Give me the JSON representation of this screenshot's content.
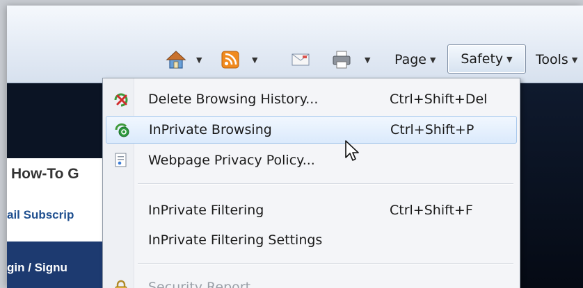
{
  "toolbar": {
    "items": [
      {
        "id": "home",
        "icon": "home-icon"
      },
      {
        "id": "feeds",
        "icon": "rss-feed-icon"
      },
      {
        "id": "mail",
        "icon": "mail-icon"
      },
      {
        "id": "print",
        "icon": "printer-icon"
      }
    ],
    "page_label": "Page",
    "safety_label": "Safety",
    "tools_label": "Tools"
  },
  "page": {
    "heading_partial": "How-To G",
    "subscribe_partial": "ail Subscrip",
    "login_partial": "gin / Signu"
  },
  "safety_menu": {
    "items": [
      {
        "label": "Delete Browsing History...",
        "shortcut": "Ctrl+Shift+Del",
        "icon": "delete-history-icon",
        "highlighted": false,
        "disabled": false
      },
      {
        "label": "InPrivate Browsing",
        "shortcut": "Ctrl+Shift+P",
        "icon": "inprivate-icon",
        "highlighted": true,
        "disabled": false
      },
      {
        "label": "Webpage Privacy Policy...",
        "shortcut": "",
        "icon": "privacy-policy-icon",
        "highlighted": false,
        "disabled": false
      },
      {
        "label": "InPrivate Filtering",
        "shortcut": "Ctrl+Shift+F",
        "icon": "",
        "highlighted": false,
        "disabled": false
      },
      {
        "label": "InPrivate Filtering Settings",
        "shortcut": "",
        "icon": "",
        "highlighted": false,
        "disabled": false
      },
      {
        "label": "Security Report",
        "shortcut": "",
        "icon": "lock-icon",
        "highlighted": false,
        "disabled": true
      }
    ]
  },
  "colors": {
    "toolbar_bg": "#e4ebf5",
    "menu_bg": "#f4f5f8",
    "highlight": "#dbeafc",
    "page_dark": "#0b1424",
    "login_bar": "#1d3a70"
  }
}
